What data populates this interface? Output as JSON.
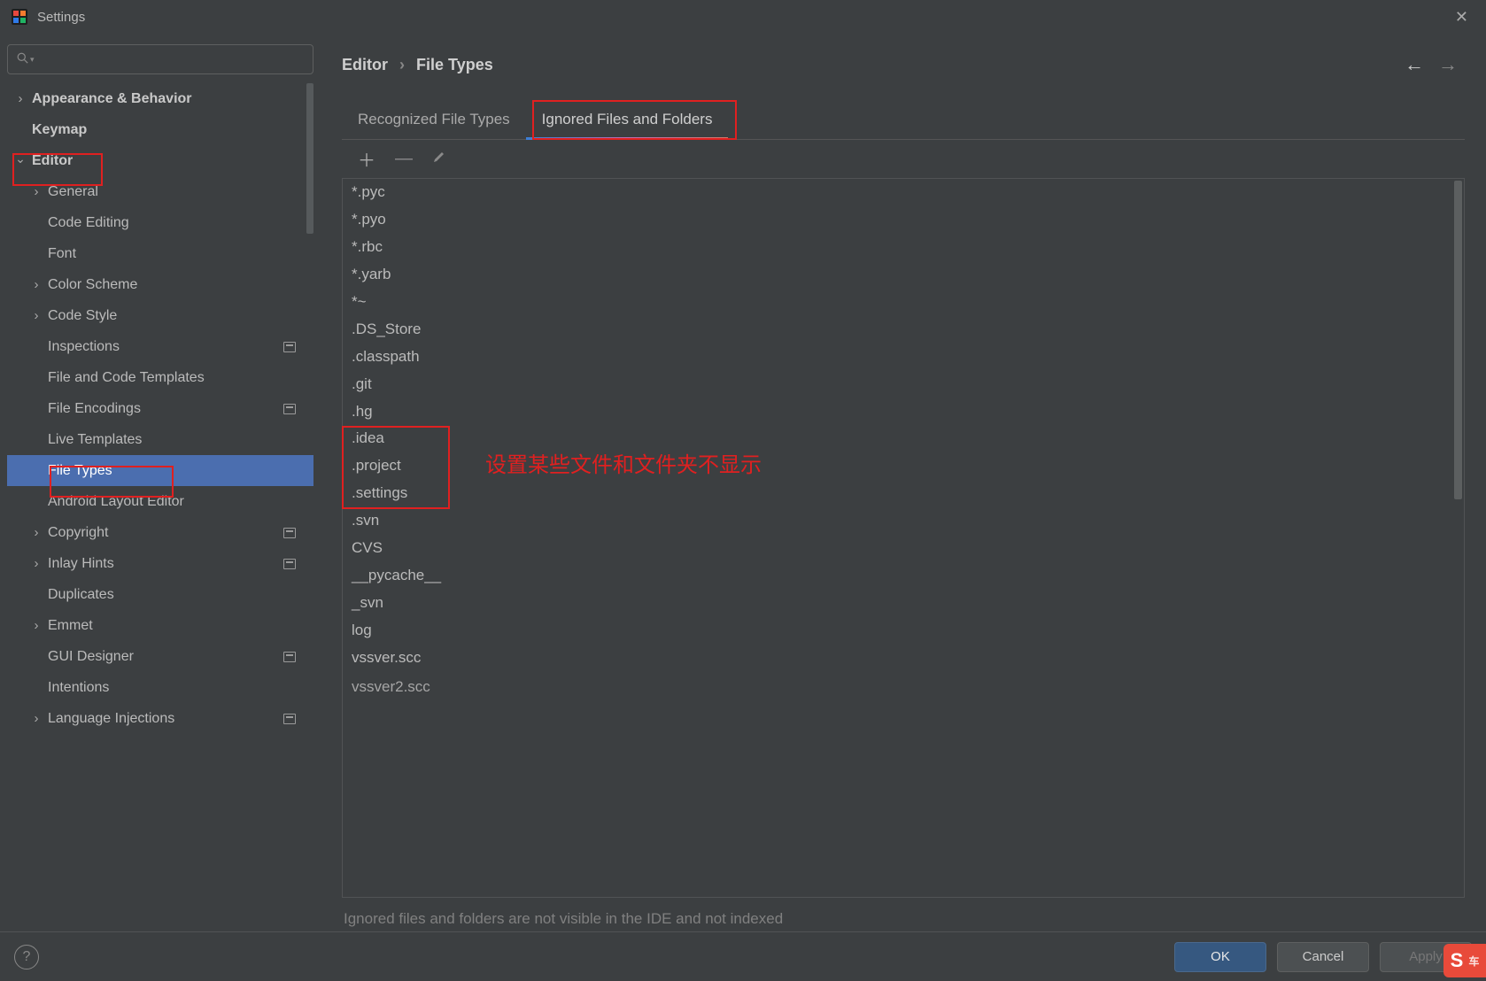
{
  "window": {
    "title": "Settings"
  },
  "breadcrumb": {
    "root": "Editor",
    "leaf": "File Types"
  },
  "tabs": {
    "recognized": "Recognized File Types",
    "ignored": "Ignored Files and Folders"
  },
  "sidebar": {
    "items": [
      {
        "label": "Appearance & Behavior",
        "arrow": "right",
        "indent": 0,
        "bold": true
      },
      {
        "label": "Keymap",
        "arrow": "none",
        "indent": 0,
        "bold": true
      },
      {
        "label": "Editor",
        "arrow": "down",
        "indent": 0,
        "bold": true
      },
      {
        "label": "General",
        "arrow": "right",
        "indent": 1
      },
      {
        "label": "Code Editing",
        "arrow": "none",
        "indent": 1
      },
      {
        "label": "Font",
        "arrow": "none",
        "indent": 1
      },
      {
        "label": "Color Scheme",
        "arrow": "right",
        "indent": 1
      },
      {
        "label": "Code Style",
        "arrow": "right",
        "indent": 1
      },
      {
        "label": "Inspections",
        "arrow": "none",
        "indent": 1,
        "badge": true
      },
      {
        "label": "File and Code Templates",
        "arrow": "none",
        "indent": 1
      },
      {
        "label": "File Encodings",
        "arrow": "none",
        "indent": 1,
        "badge": true
      },
      {
        "label": "Live Templates",
        "arrow": "none",
        "indent": 1
      },
      {
        "label": "File Types",
        "arrow": "none",
        "indent": 1,
        "selected": true
      },
      {
        "label": "Android Layout Editor",
        "arrow": "none",
        "indent": 1
      },
      {
        "label": "Copyright",
        "arrow": "right",
        "indent": 1,
        "badge": true
      },
      {
        "label": "Inlay Hints",
        "arrow": "right",
        "indent": 1,
        "badge": true
      },
      {
        "label": "Duplicates",
        "arrow": "none",
        "indent": 1
      },
      {
        "label": "Emmet",
        "arrow": "right",
        "indent": 1
      },
      {
        "label": "GUI Designer",
        "arrow": "none",
        "indent": 1,
        "badge": true
      },
      {
        "label": "Intentions",
        "arrow": "none",
        "indent": 1
      },
      {
        "label": "Language Injections",
        "arrow": "right",
        "indent": 1,
        "badge": true
      }
    ]
  },
  "patterns": [
    "*.pyc",
    "*.pyo",
    "*.rbc",
    "*.yarb",
    "*~",
    ".DS_Store",
    ".classpath",
    ".git",
    ".hg",
    ".idea",
    ".project",
    ".settings",
    ".svn",
    "CVS",
    "__pycache__",
    "_svn",
    "log",
    "vssver.scc",
    "vssver2.scc"
  ],
  "hint": "Ignored files and folders are not visible in the IDE and not indexed",
  "footer": {
    "ok": "OK",
    "cancel": "Cancel",
    "apply": "Apply"
  },
  "annotations": {
    "tab_box": true,
    "editor_box": true,
    "filetypes_box": true,
    "patterns_box": true,
    "note": "设置某些文件和文件夹不显示"
  },
  "ime": {
    "label": "S"
  }
}
